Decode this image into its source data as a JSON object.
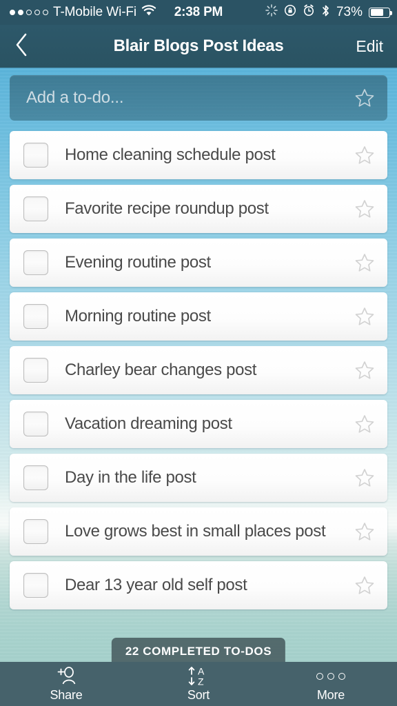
{
  "status_bar": {
    "signal_dots": [
      true,
      true,
      false,
      false,
      false
    ],
    "carrier": "T-Mobile Wi-Fi",
    "wifi_icon": "wifi-icon",
    "time": "2:38 PM",
    "icons": [
      "activity-spinner-icon",
      "rotation-lock-icon",
      "alarm-clock-icon",
      "bluetooth-icon"
    ],
    "battery_percent": "73%",
    "battery_level": 73
  },
  "nav_bar": {
    "back_icon": "chevron-left-icon",
    "title": "Blair Blogs Post Ideas",
    "edit_label": "Edit"
  },
  "add_todo": {
    "placeholder": "Add a to-do...",
    "value": "",
    "star_icon": "star-outline-icon"
  },
  "todos": [
    {
      "text": "Home cleaning schedule post",
      "checked": false,
      "starred": false
    },
    {
      "text": "Favorite recipe roundup post",
      "checked": false,
      "starred": false
    },
    {
      "text": "Evening routine post",
      "checked": false,
      "starred": false
    },
    {
      "text": "Morning routine post",
      "checked": false,
      "starred": false
    },
    {
      "text": "Charley bear changes post",
      "checked": false,
      "starred": false
    },
    {
      "text": "Vacation dreaming post",
      "checked": false,
      "starred": false
    },
    {
      "text": "Day in the life post",
      "checked": false,
      "starred": false
    },
    {
      "text": "Love grows best in small places post",
      "checked": false,
      "starred": false
    },
    {
      "text": "Dear 13 year old self post",
      "checked": false,
      "starred": false
    }
  ],
  "completed_badge": {
    "label": "22 COMPLETED TO-DOS",
    "count": 22
  },
  "toolbar": {
    "items": [
      {
        "name": "share",
        "label": "Share",
        "icon": "add-person-icon"
      },
      {
        "name": "sort",
        "label": "Sort",
        "icon": "sort-az-icon"
      },
      {
        "name": "more",
        "label": "More",
        "icon": "ellipsis-icon"
      }
    ]
  },
  "colors": {
    "status_bar": "#2b5364",
    "nav_bar": "#2d586a",
    "toolbar": "#46626b",
    "sky": "#4aa9d6",
    "sea": "#a2cfca",
    "card": "#ffffff",
    "text": "#4a4a4a",
    "badge": "#485c60"
  }
}
